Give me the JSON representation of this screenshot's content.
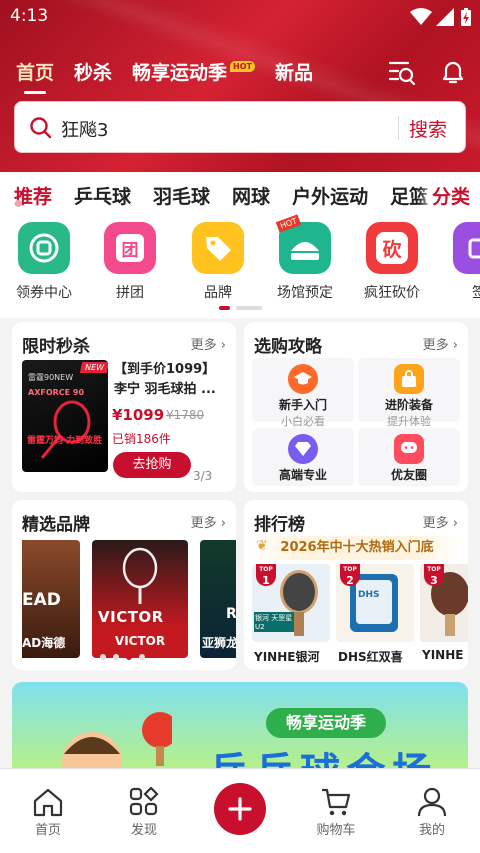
{
  "status": {
    "time": "4:13"
  },
  "top_tabs": [
    {
      "label": "首页"
    },
    {
      "label": "秒杀"
    },
    {
      "label": "畅享运动季",
      "badge": "HOT"
    },
    {
      "label": "新品"
    }
  ],
  "search": {
    "query": "狂飚3",
    "button": "搜索"
  },
  "categories": {
    "items": [
      "推荐",
      "乒乓球",
      "羽毛球",
      "网球",
      "户外运动",
      "足篮"
    ],
    "more": "分类"
  },
  "entries": [
    "领券中心",
    "拼团",
    "品牌",
    "场馆预定",
    "疯狂砍价",
    "签"
  ],
  "entry_icon_texts": {
    "group": "团",
    "bargain": "砍",
    "venue": "HOT"
  },
  "flash_sale": {
    "title": "限时秒杀",
    "more": "更多",
    "product_name": "【到手价1099】李宁 羽毛球拍 ...",
    "price": "¥1099",
    "original_price": "¥1780",
    "sold": "已销186件",
    "button": "去抢购",
    "page": "3/3",
    "img_text_top": "雷霆90NEW",
    "img_text_mid": "AXFORCE 90",
    "img_text_bottom": "雷霆万钧 力到致胜",
    "img_badge": "NEW"
  },
  "guide": {
    "title": "选购攻略",
    "more": "更多",
    "items": [
      {
        "title": "新手入门",
        "sub": "小白必看",
        "icon": "graduation-cap-icon",
        "color": "#ff6a2b"
      },
      {
        "title": "进阶装备",
        "sub": "提升体验",
        "icon": "shopping-bag-icon",
        "color": "#ffa31a"
      },
      {
        "title": "高端专业",
        "sub": "",
        "icon": "diamond-icon",
        "color": "#7b5cf0"
      },
      {
        "title": "优友圈",
        "sub": "",
        "icon": "chat-bubble-icon",
        "color": "#ff4d5f"
      }
    ]
  },
  "brands": {
    "title": "精选品牌",
    "more": "更多",
    "items": [
      "AD海德",
      "VICTOR",
      "亚狮龙"
    ],
    "logo_texts": [
      "EAD",
      "VICTOR",
      "R"
    ]
  },
  "ranking": {
    "title": "排行榜",
    "more": "更多",
    "subtitle": "2026年中十大热销入门底",
    "items": [
      {
        "rank": "1",
        "name": "YINHE银河",
        "badge": "TOP"
      },
      {
        "rank": "2",
        "name": "DHS红双喜",
        "badge": "TOP"
      },
      {
        "rank": "3",
        "name": "YINHE",
        "badge": "TOP"
      }
    ],
    "pkg_texts": [
      "银河 天罡星U2",
      "DHS"
    ]
  },
  "banner": {
    "title": "畅享运动季",
    "big": "乒乓球会场"
  },
  "nav": [
    {
      "label": "首页"
    },
    {
      "label": "发现"
    },
    {
      "label": ""
    },
    {
      "label": "购物车"
    },
    {
      "label": "我的"
    }
  ],
  "colors": {
    "brand": "#c8102e",
    "accent_gold": "#ffe3b8"
  }
}
